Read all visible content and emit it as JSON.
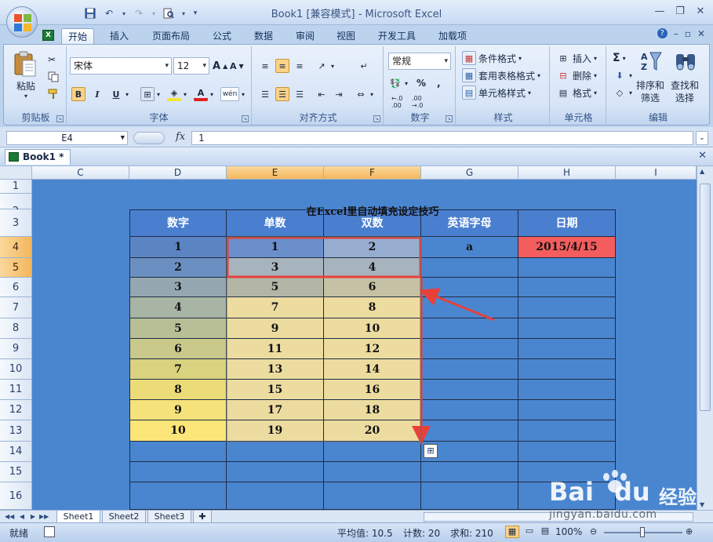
{
  "window": {
    "title": "Book1  [兼容模式] - Microsoft Excel",
    "controls": [
      "—",
      "❐",
      "✕"
    ]
  },
  "quick_access": [
    "save-icon",
    "undo-icon",
    "redo-icon",
    "print-preview-icon",
    "customize-icon"
  ],
  "ribbon_tabs": [
    {
      "label": "开始",
      "active": true
    },
    {
      "label": "插入"
    },
    {
      "label": "页面布局"
    },
    {
      "label": "公式"
    },
    {
      "label": "数据"
    },
    {
      "label": "审阅"
    },
    {
      "label": "视图"
    },
    {
      "label": "开发工具"
    },
    {
      "label": "加载项"
    }
  ],
  "ribbon": {
    "clipboard": {
      "label": "剪贴板",
      "paste": "粘贴"
    },
    "font": {
      "label": "字体",
      "name": "宋体",
      "size": "12",
      "grow": "A",
      "shrink": "A",
      "bold": "B",
      "italic": "I",
      "underline": "U",
      "font_color": "A",
      "phonetic": "wén"
    },
    "alignment": {
      "label": "对齐方式"
    },
    "number": {
      "label": "数字",
      "format": "常规",
      "percent": "%",
      "comma": ",",
      "inc": "←.0 .00",
      "dec": ".00 →.0"
    },
    "styles": {
      "label": "样式",
      "conditional": "条件格式",
      "table": "套用表格格式",
      "cell": "单元格样式"
    },
    "cells": {
      "label": "单元格",
      "insert": "插入",
      "delete": "删除",
      "format": "格式"
    },
    "editing": {
      "label": "编辑",
      "sum": "Σ",
      "sort": "排序和\n筛选",
      "find": "查找和\n选择"
    }
  },
  "formula_bar": {
    "name_box": "E4",
    "fx": "fx",
    "value": "1"
  },
  "workbook_tab": {
    "label": "Book1 *"
  },
  "columns": [
    "C",
    "D",
    "E",
    "F",
    "G",
    "H",
    "I"
  ],
  "selected_columns": [
    "E",
    "F"
  ],
  "rows": [
    "1",
    "2",
    "3",
    "4",
    "5",
    "6",
    "7",
    "8",
    "9",
    "10",
    "11",
    "12",
    "13",
    "14",
    "15",
    "16"
  ],
  "selected_rows": [
    "4",
    "5"
  ],
  "sheet": {
    "title": "在Excel里自动填充设定技巧",
    "headers": [
      "数字",
      "单数",
      "双数",
      "英语字母",
      "日期"
    ],
    "data": [
      [
        "1",
        "1",
        "2",
        "a",
        "2015/4/15"
      ],
      [
        "2",
        "3",
        "4",
        "",
        ""
      ],
      [
        "3",
        "5",
        "6",
        "",
        ""
      ],
      [
        "4",
        "7",
        "8",
        "",
        ""
      ],
      [
        "5",
        "9",
        "10",
        "",
        ""
      ],
      [
        "6",
        "11",
        "12",
        "",
        ""
      ],
      [
        "7",
        "13",
        "14",
        "",
        ""
      ],
      [
        "8",
        "15",
        "16",
        "",
        ""
      ],
      [
        "9",
        "17",
        "18",
        "",
        ""
      ],
      [
        "10",
        "19",
        "20",
        "",
        ""
      ],
      [
        "",
        "",
        "",
        "",
        ""
      ],
      [
        "",
        "",
        "",
        "",
        ""
      ],
      [
        "",
        "",
        "",
        "",
        ""
      ]
    ],
    "colors": {
      "background": "#4a86d0",
      "header": "#4a7fd0",
      "date_cell": "#f45d5d",
      "selection_border": "#e8403a",
      "arrow": "#e8403a",
      "digit_gradient": [
        "#5b84c2",
        "#6b8fc0",
        "#95a8b2",
        "#a8b4a4",
        "#b8bf96",
        "#c8c98a",
        "#d9d27e",
        "#ecdc78",
        "#f6e27a",
        "#fde679"
      ],
      "fill_cell": "#ecdca0",
      "fill_top_odd": "#6b8fcb",
      "fill_top_even": "#97add0",
      "fill_row5": "#a7b3bd"
    }
  },
  "sheet_tabs": [
    {
      "label": "Sheet1",
      "active": true
    },
    {
      "label": "Sheet2"
    },
    {
      "label": "Sheet3"
    }
  ],
  "status": {
    "ready": "就绪",
    "average": "平均值: 10.5",
    "count": "计数: 20",
    "sum": "求和: 210",
    "zoom": "100%"
  },
  "watermark": {
    "brand": "Bai",
    "brand2": "du",
    "cn": "经验",
    "url": "jingyan.baidu.com"
  }
}
